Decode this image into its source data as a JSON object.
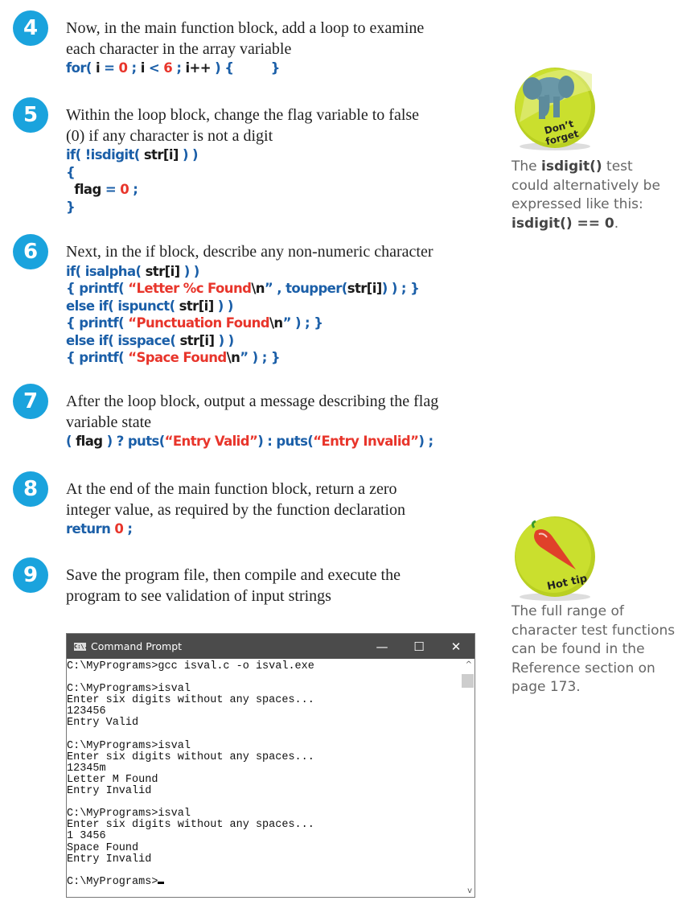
{
  "steps": [
    {
      "number": "4",
      "instruction": [
        "Now, in the main function block, add a loop to examine",
        "each character in the array variable"
      ],
      "code": [
        [
          [
            "for( ",
            "k"
          ],
          [
            "i",
            "v"
          ],
          [
            " = ",
            "k"
          ],
          [
            "0",
            "n"
          ],
          [
            " ; ",
            "k"
          ],
          [
            "i",
            "v"
          ],
          [
            " < ",
            "k"
          ],
          [
            "6",
            "n"
          ],
          [
            " ; ",
            "k"
          ],
          [
            "i++",
            "v"
          ],
          [
            " ) {         }",
            "k"
          ]
        ]
      ]
    },
    {
      "number": "5",
      "instruction": [
        "Within the loop block, change the flag variable to false",
        "(0) if any character is not a digit"
      ],
      "code": [
        [
          [
            "if( !isdigit( ",
            "k"
          ],
          [
            "str[i]",
            "v"
          ],
          [
            " ) )",
            "k"
          ]
        ],
        [
          [
            "{",
            "k"
          ]
        ],
        [
          [
            "  ",
            "k"
          ],
          [
            "flag",
            "v"
          ],
          [
            " = ",
            "k"
          ],
          [
            "0",
            "n"
          ],
          [
            " ;",
            "k"
          ]
        ],
        [
          [
            "}",
            "k"
          ]
        ]
      ]
    },
    {
      "number": "6",
      "instruction": [
        "Next, in the if block, describe any non-numeric character"
      ],
      "code": [
        [
          [
            "if( isalpha( ",
            "k"
          ],
          [
            "str[i]",
            "v"
          ],
          [
            " ) )",
            "k"
          ]
        ],
        [
          [
            "{ printf( ",
            "k"
          ],
          [
            "“Letter %c Found",
            "n"
          ],
          [
            "\\n",
            "v"
          ],
          [
            "” , toupper(",
            "k"
          ],
          [
            "str[i]",
            "v"
          ],
          [
            ") ) ; }",
            "k"
          ]
        ],
        [
          [
            "else if( ispunct( ",
            "k"
          ],
          [
            "str[i]",
            "v"
          ],
          [
            " ) )",
            "k"
          ]
        ],
        [
          [
            "{ printf( ",
            "k"
          ],
          [
            "“Punctuation Found",
            "n"
          ],
          [
            "\\n",
            "v"
          ],
          [
            "” ) ; }",
            "k"
          ]
        ],
        [
          [
            "else if( isspace( ",
            "k"
          ],
          [
            "str[i]",
            "v"
          ],
          [
            " ) )",
            "k"
          ]
        ],
        [
          [
            "{ printf( ",
            "k"
          ],
          [
            "“Space Found",
            "n"
          ],
          [
            "\\n",
            "v"
          ],
          [
            "” ) ; }",
            "k"
          ]
        ]
      ]
    },
    {
      "number": "7",
      "instruction": [
        "After the loop block, output a message describing the flag",
        "variable state"
      ],
      "code": [
        [
          [
            "( ",
            "k"
          ],
          [
            "flag",
            "v"
          ],
          [
            " ) ? puts(",
            "k"
          ],
          [
            "“Entry Valid”",
            "n"
          ],
          [
            ") : puts(",
            "k"
          ],
          [
            "“Entry Invalid”",
            "n"
          ],
          [
            ") ;",
            "k"
          ]
        ]
      ]
    },
    {
      "number": "8",
      "instruction": [
        "At the end of the main function block, return a zero",
        "integer value, as required by the function declaration"
      ],
      "code": [
        [
          [
            "return ",
            "k"
          ],
          [
            "0",
            "n"
          ],
          [
            " ;",
            "k"
          ]
        ]
      ]
    },
    {
      "number": "9",
      "instruction": [
        "Save the program file, then compile and execute the",
        "program to see validation of input strings"
      ],
      "code": []
    }
  ],
  "sidebar": {
    "dont_forget": {
      "badge_text": [
        "Don’t",
        "forget"
      ],
      "icon": "elephant-icon",
      "text": [
        [
          [
            "The ",
            ""
          ],
          [
            "isdigit()",
            "b"
          ],
          [
            " test",
            ""
          ]
        ],
        [
          [
            "could alternatively be",
            ""
          ]
        ],
        [
          [
            "expressed like this:",
            ""
          ]
        ],
        [
          [
            "isdigit() == 0",
            "b"
          ],
          [
            ".",
            ""
          ]
        ]
      ]
    },
    "hot_tip": {
      "badge_text": "Hot tip",
      "icon": "chili-pepper-icon",
      "text": [
        [
          [
            "The full range of",
            ""
          ]
        ],
        [
          [
            "character test functions",
            ""
          ]
        ],
        [
          [
            "can be found in the",
            ""
          ]
        ],
        [
          [
            "Reference section on",
            ""
          ]
        ],
        [
          [
            "page 173.",
            ""
          ]
        ]
      ]
    }
  },
  "terminal": {
    "title": "Command Prompt",
    "icon_label": "C:\\.",
    "lines": [
      "C:\\MyPrograms>gcc isval.c -o isval.exe",
      "",
      "C:\\MyPrograms>isval",
      "Enter six digits without any spaces...",
      "123456",
      "Entry Valid",
      "",
      "C:\\MyPrograms>isval",
      "Enter six digits without any spaces...",
      "12345m",
      "Letter M Found",
      "Entry Invalid",
      "",
      "C:\\MyPrograms>isval",
      "Enter six digits without any spaces...",
      "1 3456",
      "Space Found",
      "Entry Invalid",
      "",
      "C:\\MyPrograms>"
    ],
    "buttons": {
      "minimize": "—",
      "maximize": "☐",
      "close": "✕"
    }
  },
  "colors": {
    "step_circle": "#1aa3dd",
    "keyword": "#1b5fa8",
    "literal": "#e8352b",
    "badge": "#c8dc2a"
  }
}
